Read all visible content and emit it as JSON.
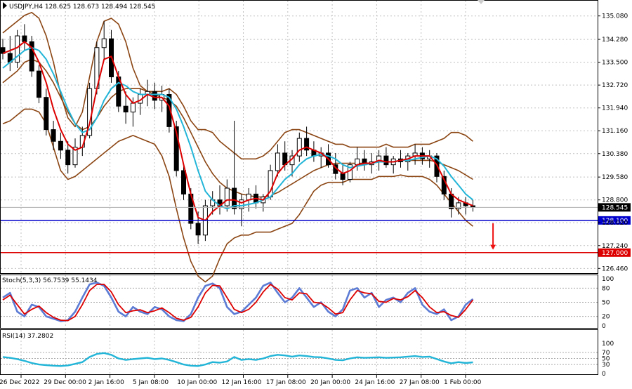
{
  "chart_data": {
    "type": "candlestick",
    "header": "USDJPY,H4  128.625 128.673 128.494 128.545",
    "main": {
      "ylim": [
        126.3,
        135.6
      ],
      "price_ticks": [
        "135.080",
        "134.280",
        "133.500",
        "132.720",
        "131.940",
        "131.160",
        "130.380",
        "129.580",
        "128.800",
        "128.020",
        "127.240",
        "126.460"
      ],
      "current_price": {
        "label": "128.545",
        "value": 128.545
      },
      "levels": [
        {
          "label": "128.100",
          "value": 128.1,
          "color": "#0000cc"
        },
        {
          "label": "127.000",
          "value": 127.0,
          "color": "#dd0000"
        }
      ],
      "arrow": {
        "color": "#ee1111",
        "x_index": 67,
        "from": 128.0,
        "to": 127.1
      },
      "ohlc": [
        [
          134.0,
          134.3,
          133.6,
          133.8
        ],
        [
          133.8,
          134.4,
          133.2,
          133.5
        ],
        [
          133.5,
          134.6,
          133.3,
          134.4
        ],
        [
          134.4,
          134.8,
          133.9,
          134.2
        ],
        [
          134.2,
          134.4,
          133.0,
          133.2
        ],
        [
          133.2,
          133.4,
          132.1,
          132.3
        ],
        [
          132.3,
          132.6,
          131.0,
          131.2
        ],
        [
          131.2,
          131.5,
          130.5,
          130.8
        ],
        [
          130.8,
          131.1,
          130.2,
          130.5
        ],
        [
          130.5,
          130.8,
          129.7,
          130.0
        ],
        [
          130.0,
          130.9,
          129.9,
          130.6
        ],
        [
          130.6,
          131.3,
          130.3,
          131.0
        ],
        [
          131.0,
          132.8,
          130.9,
          132.6
        ],
        [
          132.6,
          134.2,
          132.4,
          134.0
        ],
        [
          134.0,
          134.9,
          133.6,
          134.3
        ],
        [
          134.3,
          134.6,
          132.8,
          133.0
        ],
        [
          133.0,
          133.2,
          131.8,
          132.0
        ],
        [
          132.0,
          132.5,
          131.4,
          131.8
        ],
        [
          131.8,
          132.3,
          131.3,
          132.1
        ],
        [
          132.1,
          132.6,
          131.7,
          132.4
        ],
        [
          132.4,
          132.9,
          132.0,
          132.5
        ],
        [
          132.5,
          132.8,
          131.9,
          132.2
        ],
        [
          132.2,
          132.7,
          131.8,
          132.4
        ],
        [
          132.4,
          132.6,
          131.1,
          131.3
        ],
        [
          131.3,
          131.5,
          129.6,
          129.8
        ],
        [
          129.8,
          130.0,
          128.8,
          129.0
        ],
        [
          129.0,
          129.2,
          127.8,
          128.0
        ],
        [
          128.0,
          128.4,
          127.3,
          127.6
        ],
        [
          127.6,
          128.8,
          127.4,
          128.6
        ],
        [
          128.6,
          129.1,
          128.3,
          128.8
        ],
        [
          128.8,
          129.3,
          128.3,
          128.6
        ],
        [
          128.6,
          129.5,
          128.4,
          129.2
        ],
        [
          129.2,
          131.5,
          128.3,
          128.5
        ],
        [
          128.5,
          129.0,
          127.9,
          128.8
        ],
        [
          128.8,
          129.2,
          128.4,
          129.0
        ],
        [
          129.0,
          129.3,
          128.5,
          128.7
        ],
        [
          128.7,
          129.0,
          128.4,
          128.9
        ],
        [
          128.9,
          130.0,
          128.8,
          129.8
        ],
        [
          129.8,
          130.7,
          129.6,
          130.4
        ],
        [
          130.4,
          130.8,
          129.8,
          130.0
        ],
        [
          130.0,
          130.5,
          129.6,
          130.3
        ],
        [
          130.3,
          131.1,
          130.1,
          130.9
        ],
        [
          130.9,
          131.3,
          130.3,
          130.5
        ],
        [
          130.5,
          130.8,
          130.1,
          130.3
        ],
        [
          130.3,
          130.6,
          129.9,
          130.4
        ],
        [
          130.4,
          130.7,
          129.9,
          130.0
        ],
        [
          130.0,
          130.4,
          129.5,
          129.7
        ],
        [
          129.7,
          130.0,
          129.3,
          129.5
        ],
        [
          129.5,
          130.1,
          129.4,
          130.0
        ],
        [
          130.0,
          130.6,
          129.8,
          130.2
        ],
        [
          130.2,
          130.5,
          129.8,
          130.0
        ],
        [
          130.0,
          130.4,
          129.7,
          130.1
        ],
        [
          130.1,
          130.5,
          129.8,
          130.3
        ],
        [
          130.3,
          130.6,
          129.9,
          130.0
        ],
        [
          130.0,
          130.3,
          129.7,
          130.2
        ],
        [
          130.2,
          130.5,
          129.9,
          130.1
        ],
        [
          130.1,
          130.4,
          129.8,
          130.3
        ],
        [
          130.3,
          130.7,
          130.0,
          130.4
        ],
        [
          130.4,
          130.6,
          130.0,
          130.2
        ],
        [
          130.2,
          130.5,
          129.9,
          130.3
        ],
        [
          130.3,
          130.4,
          129.4,
          129.6
        ],
        [
          129.6,
          129.8,
          128.8,
          129.0
        ],
        [
          129.0,
          129.2,
          128.2,
          128.5
        ],
        [
          128.5,
          128.9,
          128.3,
          128.7
        ],
        [
          128.7,
          128.9,
          128.3,
          128.6
        ],
        [
          128.6,
          128.8,
          128.4,
          128.55
        ]
      ],
      "upper_band": [
        134.5,
        134.7,
        134.9,
        135.1,
        135.2,
        135.0,
        134.4,
        133.5,
        132.4,
        131.6,
        131.3,
        131.8,
        133.0,
        134.2,
        134.9,
        135.0,
        134.8,
        134.2,
        133.3,
        132.7,
        132.5,
        132.5,
        132.5,
        132.6,
        132.4,
        132.0,
        131.5,
        131.2,
        131.2,
        131.1,
        130.8,
        130.6,
        130.4,
        130.2,
        130.2,
        130.2,
        130.3,
        130.5,
        130.8,
        131.1,
        131.2,
        131.2,
        131.1,
        131.0,
        130.9,
        130.8,
        130.7,
        130.7,
        130.6,
        130.6,
        130.6,
        130.6,
        130.6,
        130.7,
        130.6,
        130.6,
        130.6,
        130.7,
        130.7,
        130.7,
        130.8,
        130.9,
        131.1,
        131.1,
        131.0,
        130.8
      ],
      "middle_band": [
        132.8,
        133.0,
        133.2,
        133.5,
        133.6,
        133.5,
        133.2,
        132.8,
        132.3,
        131.8,
        131.4,
        131.2,
        131.3,
        131.6,
        132.0,
        132.3,
        132.5,
        132.6,
        132.6,
        132.6,
        132.5,
        132.4,
        132.3,
        132.2,
        132.0,
        131.6,
        131.1,
        130.6,
        130.1,
        129.7,
        129.4,
        129.2,
        129.1,
        129.0,
        128.95,
        128.9,
        128.9,
        128.95,
        129.05,
        129.2,
        129.35,
        129.5,
        129.65,
        129.8,
        129.9,
        130.0,
        130.05,
        130.05,
        130.05,
        130.05,
        130.05,
        130.05,
        130.1,
        130.1,
        130.1,
        130.15,
        130.15,
        130.15,
        130.15,
        130.15,
        130.1,
        130.0,
        129.9,
        129.8,
        129.65,
        129.5
      ],
      "lower_band": [
        131.4,
        131.5,
        131.7,
        131.9,
        131.9,
        131.8,
        131.4,
        130.6,
        129.8,
        129.5,
        129.6,
        129.8,
        130.0,
        130.2,
        130.4,
        130.6,
        130.8,
        130.9,
        131.0,
        130.9,
        130.8,
        130.7,
        130.3,
        129.6,
        128.5,
        127.5,
        126.7,
        126.2,
        126.0,
        126.2,
        126.8,
        127.3,
        127.5,
        127.6,
        127.6,
        127.7,
        127.7,
        127.7,
        127.8,
        127.9,
        128.0,
        128.3,
        128.7,
        129.1,
        129.3,
        129.4,
        129.4,
        129.4,
        129.5,
        129.5,
        129.5,
        129.5,
        129.6,
        129.6,
        129.6,
        129.65,
        129.6,
        129.6,
        129.6,
        129.5,
        129.3,
        129.0,
        128.7,
        128.4,
        128.1,
        127.9
      ],
      "fast_ma": [
        133.8,
        133.9,
        134.0,
        134.2,
        134.0,
        133.5,
        132.8,
        131.9,
        131.2,
        130.7,
        130.5,
        130.6,
        131.4,
        132.6,
        133.6,
        133.7,
        133.0,
        132.4,
        132.1,
        132.2,
        132.4,
        132.3,
        132.3,
        132.0,
        131.1,
        130.0,
        129.0,
        128.2,
        128.1,
        128.4,
        128.6,
        128.8,
        128.8,
        128.7,
        128.8,
        128.85,
        128.8,
        129.1,
        129.7,
        130.0,
        130.2,
        130.5,
        130.6,
        130.5,
        130.4,
        130.2,
        129.9,
        129.7,
        129.8,
        130.0,
        130.05,
        130.05,
        130.15,
        130.1,
        130.1,
        130.15,
        130.2,
        130.3,
        130.3,
        130.3,
        130.0,
        129.5,
        129.0,
        128.8,
        128.7,
        128.6
      ],
      "slow_ma": [
        133.3,
        133.5,
        133.7,
        133.9,
        134.0,
        133.9,
        133.6,
        133.1,
        132.5,
        131.9,
        131.4,
        131.1,
        131.2,
        131.6,
        132.2,
        132.6,
        132.8,
        132.7,
        132.5,
        132.4,
        132.4,
        132.4,
        132.4,
        132.3,
        131.9,
        131.3,
        130.6,
        129.8,
        129.1,
        128.8,
        128.6,
        128.5,
        128.6,
        128.6,
        128.65,
        128.7,
        128.8,
        128.9,
        129.2,
        129.5,
        129.7,
        130.0,
        130.2,
        130.3,
        130.35,
        130.3,
        130.2,
        130.0,
        129.9,
        129.95,
        130.0,
        130.05,
        130.1,
        130.1,
        130.1,
        130.15,
        130.15,
        130.2,
        130.25,
        130.3,
        130.2,
        129.95,
        129.6,
        129.3,
        129.0,
        128.8
      ]
    },
    "stochastic": {
      "label": "Stoch(5,3,3) 56.7539 55.1434",
      "ylim": [
        0,
        100
      ],
      "ticks": [
        "100",
        "80",
        "50",
        "20",
        "0"
      ],
      "levels": [
        20,
        50,
        80
      ],
      "k": [
        60,
        70,
        30,
        20,
        45,
        40,
        20,
        15,
        10,
        12,
        30,
        60,
        88,
        92,
        85,
        60,
        30,
        20,
        40,
        30,
        25,
        40,
        35,
        20,
        12,
        10,
        25,
        60,
        85,
        90,
        80,
        40,
        25,
        30,
        45,
        60,
        85,
        92,
        70,
        50,
        60,
        80,
        60,
        40,
        50,
        30,
        20,
        35,
        75,
        80,
        60,
        70,
        40,
        55,
        60,
        50,
        70,
        80,
        45,
        30,
        25,
        35,
        12,
        20,
        45,
        56.8
      ],
      "d": [
        55,
        65,
        45,
        25,
        35,
        42,
        28,
        18,
        12,
        11,
        20,
        45,
        75,
        88,
        88,
        72,
        45,
        28,
        32,
        34,
        28,
        32,
        38,
        28,
        16,
        12,
        18,
        40,
        70,
        86,
        85,
        60,
        35,
        28,
        35,
        50,
        72,
        88,
        78,
        60,
        55,
        70,
        68,
        50,
        48,
        38,
        25,
        28,
        55,
        75,
        70,
        68,
        52,
        50,
        58,
        55,
        62,
        75,
        60,
        40,
        28,
        30,
        22,
        18,
        35,
        55.1
      ]
    },
    "rsi": {
      "label": "RSI(14) 37.2802",
      "ylim": [
        0,
        100
      ],
      "ticks": [
        "100",
        "70",
        "50",
        "30",
        "0"
      ],
      "levels": [
        30,
        50,
        70
      ],
      "values": [
        55,
        52,
        48,
        42,
        35,
        30,
        28,
        26,
        25,
        27,
        32,
        38,
        55,
        65,
        68,
        62,
        50,
        45,
        48,
        50,
        52,
        48,
        50,
        45,
        38,
        30,
        26,
        25,
        30,
        38,
        36,
        40,
        55,
        45,
        48,
        45,
        50,
        58,
        62,
        60,
        56,
        60,
        58,
        55,
        54,
        50,
        45,
        44,
        50,
        54,
        52,
        53,
        54,
        52,
        53,
        54,
        56,
        58,
        55,
        56,
        48,
        40,
        34,
        38,
        35,
        37.3
      ]
    },
    "time_labels": [
      "26 Dec 2022",
      "29 Dec 00:00",
      "2 Jan 16:00",
      "5 Jan 08:00",
      "10 Jan 00:00",
      "12 Jan 16:00",
      "17 Jan 08:00",
      "20 Jan 00:00",
      "24 Jan 16:00",
      "27 Jan 08:00",
      "1 Feb 00:00"
    ],
    "colors": {
      "up": "#000000",
      "down": "#000000",
      "bands": "#8b4513",
      "fast_ma": "#dd0000",
      "slow_ma": "#22b5d8",
      "stoch_k": "#5b7bd5",
      "stoch_d": "#dd0000",
      "rsi": "#22b5d8",
      "grid": "#c0c0c0",
      "price_box": "#000000"
    }
  }
}
